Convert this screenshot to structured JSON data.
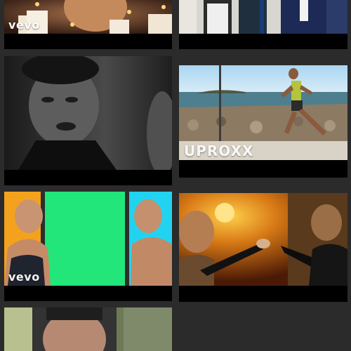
{
  "feed": {
    "cards": [
      {
        "id": "c1",
        "watermark": "vevo",
        "scene": "candles"
      },
      {
        "id": "c2",
        "watermark": "",
        "scene": "office"
      },
      {
        "id": "c3",
        "watermark": "",
        "scene": "bw-portrait"
      },
      {
        "id": "c4",
        "watermark": "UPROXX",
        "scene": "runner"
      },
      {
        "id": "c5",
        "watermark": "vevo",
        "scene": "two-men-colors"
      },
      {
        "id": "c6",
        "watermark": "",
        "scene": "sunset-hands"
      },
      {
        "id": "c7",
        "watermark": "",
        "scene": "man-portrait"
      }
    ]
  },
  "colors": {
    "background": "#2b2b2b",
    "card": "#000000",
    "green_panel": "#22e67a",
    "cyan_panel": "#22d3f0",
    "orange_panel": "#f4a21d"
  }
}
